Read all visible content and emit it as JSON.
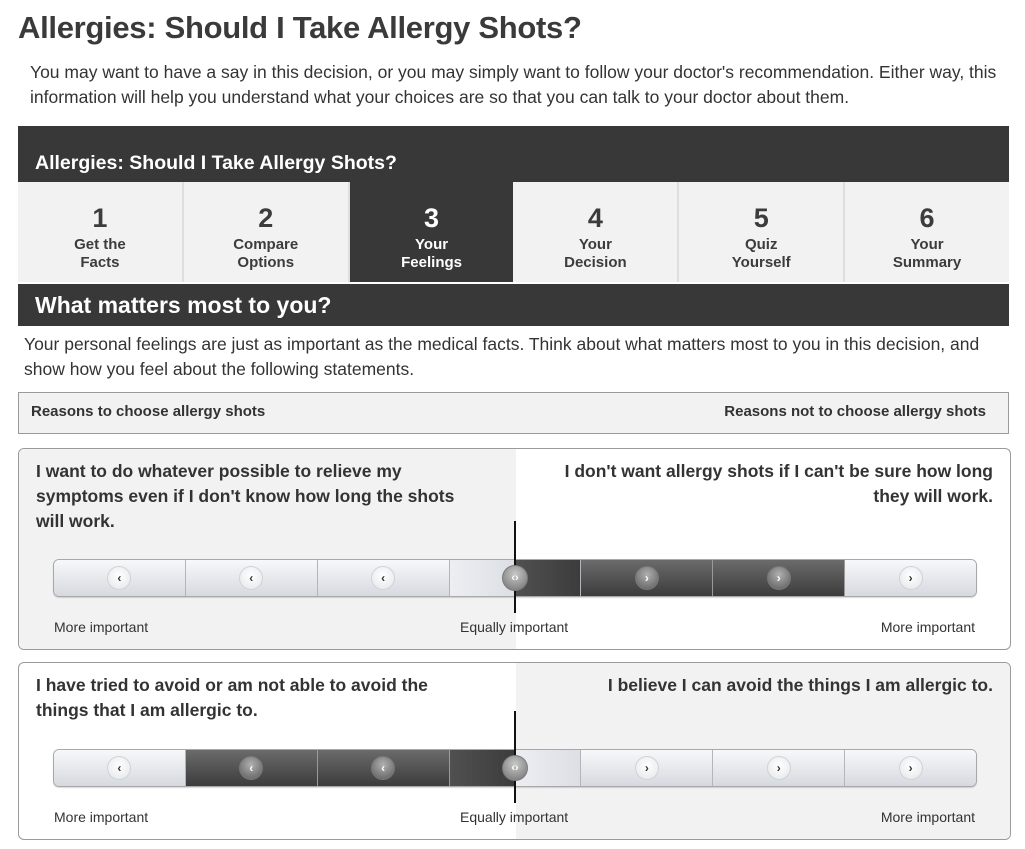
{
  "page": {
    "title": "Allergies: Should I Take Allergy Shots?",
    "intro": "You may want to have a say in this decision, or you may simply want to follow your doctor's recommendation. Either way, this information will help you understand what your choices are so that you can talk to your doctor about them."
  },
  "tool": {
    "title": "Allergies: Should I Take Allergy Shots?",
    "steps": [
      {
        "num": "1",
        "label_line1": "Get the",
        "label_line2": "Facts",
        "active": false
      },
      {
        "num": "2",
        "label_line1": "Compare",
        "label_line2": "Options",
        "active": false
      },
      {
        "num": "3",
        "label_line1": "Your",
        "label_line2": "Feelings",
        "active": true
      },
      {
        "num": "4",
        "label_line1": "Your",
        "label_line2": "Decision",
        "active": false
      },
      {
        "num": "5",
        "label_line1": "Quiz",
        "label_line2": "Yourself",
        "active": false
      },
      {
        "num": "6",
        "label_line1": "Your",
        "label_line2": "Summary",
        "active": false
      }
    ]
  },
  "section": {
    "title": "What matters most to you?",
    "intro": "Your personal feelings are just as important as the medical facts. Think about what matters most to you in this decision, and show how you feel about the following statements."
  },
  "reasons_header": {
    "left": "Reasons to choose allergy shots",
    "right": "Reasons not to choose allergy shots"
  },
  "scale_labels": {
    "left": "More important",
    "middle": "Equally important",
    "right": "More important"
  },
  "icons": {
    "left_arrow": "‹",
    "right_arrow": "›",
    "handle": "‹›"
  },
  "statements": [
    {
      "left": "I want to do whatever possible to relieve my symptoms even if I don't know how long the shots will work.",
      "right": "I don't want allergy shots if I can't be sure how long they will work.",
      "selected_value": 2,
      "scale_range": [
        -3,
        3
      ],
      "selected_side": "right"
    },
    {
      "left": "I have tried to avoid or am not able to avoid the things that I am allergic to.",
      "right": "I believe I can avoid the things I am allergic to.",
      "selected_value": -2,
      "scale_range": [
        -3,
        3
      ],
      "selected_side": "left"
    }
  ]
}
